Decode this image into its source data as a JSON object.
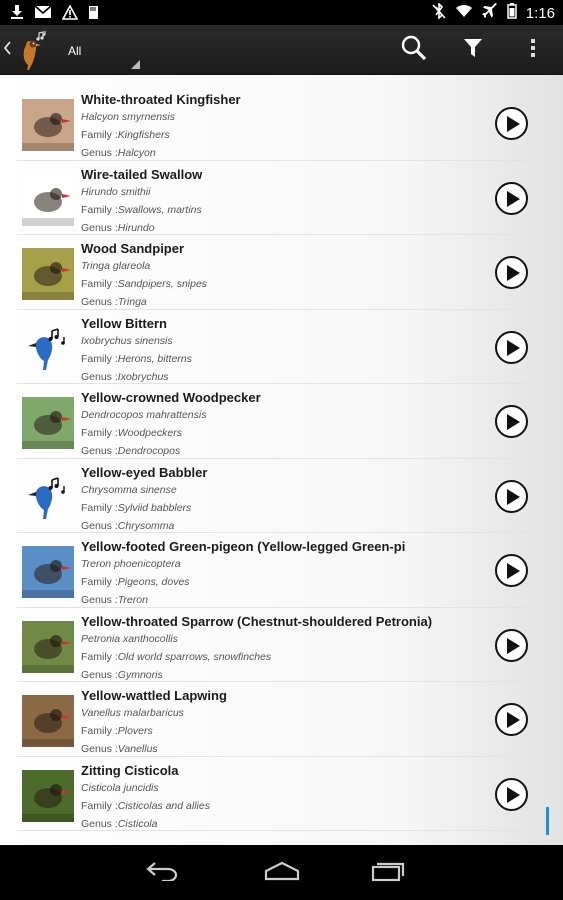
{
  "status_bar": {
    "time": "1:16",
    "left_icons": [
      "download-icon",
      "mail-icon",
      "warning-icon",
      "sd-card-icon"
    ],
    "right_icons": [
      "bluetooth-muted-icon",
      "wifi-icon",
      "airplane-icon",
      "battery-icon"
    ]
  },
  "action_bar": {
    "filter_value": "All",
    "actions": [
      "search-icon",
      "filter-icon",
      "overflow-menu-icon"
    ]
  },
  "birds": [
    {
      "name": "White-throated Kingfisher",
      "scientific": "Halcyon smyrnensis",
      "family_label": "Family :",
      "family": "Kingfishers",
      "genus_label": "Genus :",
      "genus": "Halcyon",
      "thumb": "photo",
      "color": "#c9a58a"
    },
    {
      "name": "Wire-tailed Swallow",
      "scientific": "Hirundo smithii",
      "family_label": "Family :",
      "family": "Swallows, martins",
      "genus_label": "Genus :",
      "genus": "Hirundo",
      "thumb": "photo",
      "color": "#ffffff"
    },
    {
      "name": "Wood Sandpiper",
      "scientific": "Tringa glareola",
      "family_label": "Family :",
      "family": "Sandpipers, snipes",
      "genus_label": "Genus :",
      "genus": "Tringa",
      "thumb": "photo",
      "color": "#a7a04a"
    },
    {
      "name": "Yellow Bittern",
      "scientific": "Ixobrychus sinensis",
      "family_label": "Family :",
      "family": "Herons, bitterns",
      "genus_label": "Genus :",
      "genus": "Ixobrychus",
      "thumb": "placeholder",
      "color": "#2a6cc4"
    },
    {
      "name": "Yellow-crowned Woodpecker",
      "scientific": "Dendrocopos mahrattensis",
      "family_label": "Family :",
      "family": "Woodpeckers",
      "genus_label": "Genus :",
      "genus": "Dendrocopos",
      "thumb": "photo",
      "color": "#7fa86a"
    },
    {
      "name": "Yellow-eyed Babbler",
      "scientific": "Chrysomma sinense",
      "family_label": "Family :",
      "family": "Sylviid babblers",
      "genus_label": "Genus :",
      "genus": "Chrysomma",
      "thumb": "placeholder",
      "color": "#2a6cc4"
    },
    {
      "name": "Yellow-footed Green-pigeon (Yellow-legged Green-pi",
      "scientific": "Treron phoenicoptera",
      "family_label": "Family :",
      "family": "Pigeons, doves",
      "genus_label": "Genus :",
      "genus": "Treron",
      "thumb": "photo",
      "color": "#5b8fc7"
    },
    {
      "name": "Yellow-throated Sparrow (Chestnut-shouldered Petronia)",
      "scientific": "Petronia xanthocollis",
      "family_label": "Family :",
      "family": "Old world sparrows, snowfinches",
      "genus_label": "Genus :",
      "genus": "Gymnoris",
      "thumb": "photo",
      "color": "#6e8a45"
    },
    {
      "name": "Yellow-wattled Lapwing",
      "scientific": "Vanellus malarbaricus",
      "family_label": "Family :",
      "family": "Plovers",
      "genus_label": "Genus :",
      "genus": "Vanellus",
      "thumb": "photo",
      "color": "#8a6a45"
    },
    {
      "name": "Zitting Cisticola",
      "scientific": "Cisticola juncidis",
      "family_label": "Family :",
      "family": "Cisticolas and allies",
      "genus_label": "Genus :",
      "genus": "Cisticola",
      "thumb": "photo",
      "color": "#4d6b2a"
    }
  ],
  "nav_bar": [
    "back-icon",
    "home-icon",
    "recent-apps-icon"
  ]
}
